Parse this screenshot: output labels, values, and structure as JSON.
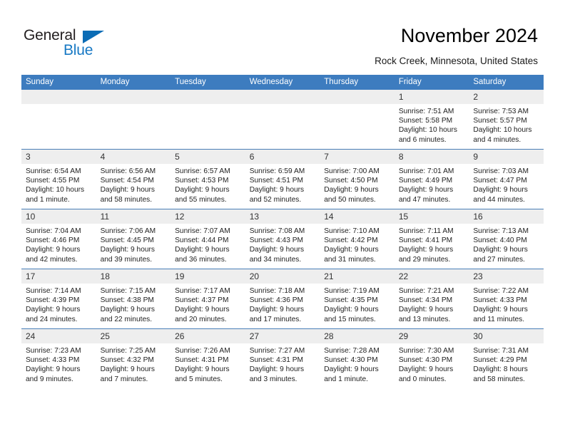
{
  "brand": {
    "name_top": "General",
    "name_bottom": "Blue",
    "accent_color": "#1879c4",
    "triangle_color": "#0b6cb5"
  },
  "header": {
    "title": "November 2024",
    "subtitle": "Rock Creek, Minnesota, United States"
  },
  "theme": {
    "header_row_bg": "#3d7cbf",
    "daynum_bg": "#eeeeee",
    "grid_line": "#4a7fb8"
  },
  "calendar": {
    "weekday_headers": [
      "Sunday",
      "Monday",
      "Tuesday",
      "Wednesday",
      "Thursday",
      "Friday",
      "Saturday"
    ],
    "weeks": [
      [
        {
          "day": "",
          "empty": true,
          "sunrise": "",
          "sunset": "",
          "daylight_1": "",
          "daylight_2": ""
        },
        {
          "day": "",
          "empty": true,
          "sunrise": "",
          "sunset": "",
          "daylight_1": "",
          "daylight_2": ""
        },
        {
          "day": "",
          "empty": true,
          "sunrise": "",
          "sunset": "",
          "daylight_1": "",
          "daylight_2": ""
        },
        {
          "day": "",
          "empty": true,
          "sunrise": "",
          "sunset": "",
          "daylight_1": "",
          "daylight_2": ""
        },
        {
          "day": "",
          "empty": true,
          "sunrise": "",
          "sunset": "",
          "daylight_1": "",
          "daylight_2": ""
        },
        {
          "day": "1",
          "empty": false,
          "sunrise": "Sunrise: 7:51 AM",
          "sunset": "Sunset: 5:58 PM",
          "daylight_1": "Daylight: 10 hours",
          "daylight_2": "and 6 minutes."
        },
        {
          "day": "2",
          "empty": false,
          "sunrise": "Sunrise: 7:53 AM",
          "sunset": "Sunset: 5:57 PM",
          "daylight_1": "Daylight: 10 hours",
          "daylight_2": "and 4 minutes."
        }
      ],
      [
        {
          "day": "3",
          "empty": false,
          "sunrise": "Sunrise: 6:54 AM",
          "sunset": "Sunset: 4:55 PM",
          "daylight_1": "Daylight: 10 hours",
          "daylight_2": "and 1 minute."
        },
        {
          "day": "4",
          "empty": false,
          "sunrise": "Sunrise: 6:56 AM",
          "sunset": "Sunset: 4:54 PM",
          "daylight_1": "Daylight: 9 hours",
          "daylight_2": "and 58 minutes."
        },
        {
          "day": "5",
          "empty": false,
          "sunrise": "Sunrise: 6:57 AM",
          "sunset": "Sunset: 4:53 PM",
          "daylight_1": "Daylight: 9 hours",
          "daylight_2": "and 55 minutes."
        },
        {
          "day": "6",
          "empty": false,
          "sunrise": "Sunrise: 6:59 AM",
          "sunset": "Sunset: 4:51 PM",
          "daylight_1": "Daylight: 9 hours",
          "daylight_2": "and 52 minutes."
        },
        {
          "day": "7",
          "empty": false,
          "sunrise": "Sunrise: 7:00 AM",
          "sunset": "Sunset: 4:50 PM",
          "daylight_1": "Daylight: 9 hours",
          "daylight_2": "and 50 minutes."
        },
        {
          "day": "8",
          "empty": false,
          "sunrise": "Sunrise: 7:01 AM",
          "sunset": "Sunset: 4:49 PM",
          "daylight_1": "Daylight: 9 hours",
          "daylight_2": "and 47 minutes."
        },
        {
          "day": "9",
          "empty": false,
          "sunrise": "Sunrise: 7:03 AM",
          "sunset": "Sunset: 4:47 PM",
          "daylight_1": "Daylight: 9 hours",
          "daylight_2": "and 44 minutes."
        }
      ],
      [
        {
          "day": "10",
          "empty": false,
          "sunrise": "Sunrise: 7:04 AM",
          "sunset": "Sunset: 4:46 PM",
          "daylight_1": "Daylight: 9 hours",
          "daylight_2": "and 42 minutes."
        },
        {
          "day": "11",
          "empty": false,
          "sunrise": "Sunrise: 7:06 AM",
          "sunset": "Sunset: 4:45 PM",
          "daylight_1": "Daylight: 9 hours",
          "daylight_2": "and 39 minutes."
        },
        {
          "day": "12",
          "empty": false,
          "sunrise": "Sunrise: 7:07 AM",
          "sunset": "Sunset: 4:44 PM",
          "daylight_1": "Daylight: 9 hours",
          "daylight_2": "and 36 minutes."
        },
        {
          "day": "13",
          "empty": false,
          "sunrise": "Sunrise: 7:08 AM",
          "sunset": "Sunset: 4:43 PM",
          "daylight_1": "Daylight: 9 hours",
          "daylight_2": "and 34 minutes."
        },
        {
          "day": "14",
          "empty": false,
          "sunrise": "Sunrise: 7:10 AM",
          "sunset": "Sunset: 4:42 PM",
          "daylight_1": "Daylight: 9 hours",
          "daylight_2": "and 31 minutes."
        },
        {
          "day": "15",
          "empty": false,
          "sunrise": "Sunrise: 7:11 AM",
          "sunset": "Sunset: 4:41 PM",
          "daylight_1": "Daylight: 9 hours",
          "daylight_2": "and 29 minutes."
        },
        {
          "day": "16",
          "empty": false,
          "sunrise": "Sunrise: 7:13 AM",
          "sunset": "Sunset: 4:40 PM",
          "daylight_1": "Daylight: 9 hours",
          "daylight_2": "and 27 minutes."
        }
      ],
      [
        {
          "day": "17",
          "empty": false,
          "sunrise": "Sunrise: 7:14 AM",
          "sunset": "Sunset: 4:39 PM",
          "daylight_1": "Daylight: 9 hours",
          "daylight_2": "and 24 minutes."
        },
        {
          "day": "18",
          "empty": false,
          "sunrise": "Sunrise: 7:15 AM",
          "sunset": "Sunset: 4:38 PM",
          "daylight_1": "Daylight: 9 hours",
          "daylight_2": "and 22 minutes."
        },
        {
          "day": "19",
          "empty": false,
          "sunrise": "Sunrise: 7:17 AM",
          "sunset": "Sunset: 4:37 PM",
          "daylight_1": "Daylight: 9 hours",
          "daylight_2": "and 20 minutes."
        },
        {
          "day": "20",
          "empty": false,
          "sunrise": "Sunrise: 7:18 AM",
          "sunset": "Sunset: 4:36 PM",
          "daylight_1": "Daylight: 9 hours",
          "daylight_2": "and 17 minutes."
        },
        {
          "day": "21",
          "empty": false,
          "sunrise": "Sunrise: 7:19 AM",
          "sunset": "Sunset: 4:35 PM",
          "daylight_1": "Daylight: 9 hours",
          "daylight_2": "and 15 minutes."
        },
        {
          "day": "22",
          "empty": false,
          "sunrise": "Sunrise: 7:21 AM",
          "sunset": "Sunset: 4:34 PM",
          "daylight_1": "Daylight: 9 hours",
          "daylight_2": "and 13 minutes."
        },
        {
          "day": "23",
          "empty": false,
          "sunrise": "Sunrise: 7:22 AM",
          "sunset": "Sunset: 4:33 PM",
          "daylight_1": "Daylight: 9 hours",
          "daylight_2": "and 11 minutes."
        }
      ],
      [
        {
          "day": "24",
          "empty": false,
          "sunrise": "Sunrise: 7:23 AM",
          "sunset": "Sunset: 4:33 PM",
          "daylight_1": "Daylight: 9 hours",
          "daylight_2": "and 9 minutes."
        },
        {
          "day": "25",
          "empty": false,
          "sunrise": "Sunrise: 7:25 AM",
          "sunset": "Sunset: 4:32 PM",
          "daylight_1": "Daylight: 9 hours",
          "daylight_2": "and 7 minutes."
        },
        {
          "day": "26",
          "empty": false,
          "sunrise": "Sunrise: 7:26 AM",
          "sunset": "Sunset: 4:31 PM",
          "daylight_1": "Daylight: 9 hours",
          "daylight_2": "and 5 minutes."
        },
        {
          "day": "27",
          "empty": false,
          "sunrise": "Sunrise: 7:27 AM",
          "sunset": "Sunset: 4:31 PM",
          "daylight_1": "Daylight: 9 hours",
          "daylight_2": "and 3 minutes."
        },
        {
          "day": "28",
          "empty": false,
          "sunrise": "Sunrise: 7:28 AM",
          "sunset": "Sunset: 4:30 PM",
          "daylight_1": "Daylight: 9 hours",
          "daylight_2": "and 1 minute."
        },
        {
          "day": "29",
          "empty": false,
          "sunrise": "Sunrise: 7:30 AM",
          "sunset": "Sunset: 4:30 PM",
          "daylight_1": "Daylight: 9 hours",
          "daylight_2": "and 0 minutes."
        },
        {
          "day": "30",
          "empty": false,
          "sunrise": "Sunrise: 7:31 AM",
          "sunset": "Sunset: 4:29 PM",
          "daylight_1": "Daylight: 8 hours",
          "daylight_2": "and 58 minutes."
        }
      ]
    ]
  }
}
